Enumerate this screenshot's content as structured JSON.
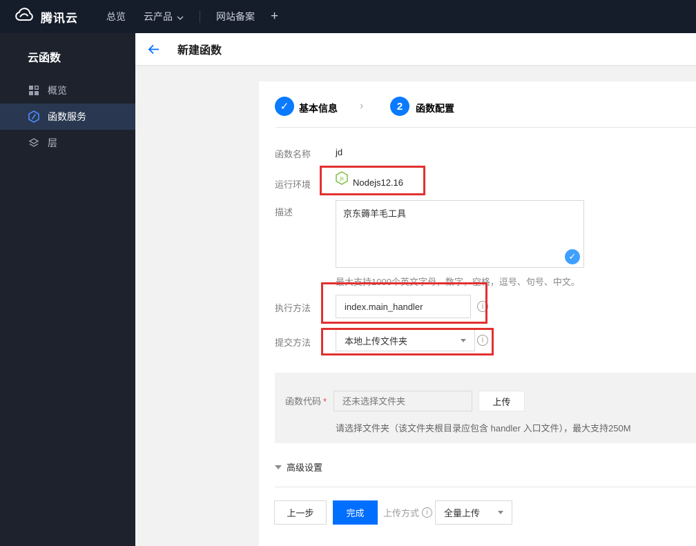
{
  "navbar": {
    "brand": "腾讯云",
    "items": [
      {
        "label": "总览"
      },
      {
        "label": "云产品"
      },
      {
        "label": "网站备案"
      },
      {
        "label": "+"
      }
    ]
  },
  "sidebar": {
    "title": "云函数",
    "items": [
      {
        "label": "概览",
        "icon": "grid-icon",
        "active": false
      },
      {
        "label": "函数服务",
        "icon": "function-hexagon-icon",
        "active": true
      },
      {
        "label": "层",
        "icon": "layers-icon",
        "active": false
      }
    ]
  },
  "header": {
    "title": "新建函数",
    "back_icon": "arrow-left"
  },
  "steps": [
    {
      "mark": "✓",
      "label": "基本信息",
      "state": "done"
    },
    {
      "mark": "2",
      "label": "函数配置",
      "state": "current"
    }
  ],
  "form": {
    "function_name": {
      "label": "函数名称",
      "value": "jd"
    },
    "runtime": {
      "label": "运行环境",
      "value": "Nodejs12.16",
      "icon": "nodejs-icon"
    },
    "description": {
      "label": "描述",
      "value": "京东薅羊毛工具",
      "hint": "最大支持1000个英文字母，数字，空格，逗号、句号、中文。"
    },
    "handler": {
      "label": "执行方法",
      "value": "index.main_handler"
    },
    "submit_method": {
      "label": "提交方法",
      "value": "本地上传文件夹"
    },
    "function_code": {
      "label": "函数代码",
      "required_mark": "*",
      "placeholder": "还未选择文件夹",
      "upload_button": "上传",
      "hint": "请选择文件夹（该文件夹根目录应包含 handler 入口文件），最大支持250M"
    },
    "advanced_label": "高级设置"
  },
  "footer": {
    "prev_button": "上一步",
    "finish_button": "完成",
    "upload_mode_label": "上传方式",
    "upload_mode_value": "全量上传",
    "info_glyph": "i"
  },
  "colors": {
    "accent_blue": "#006eff",
    "step_blue": "#0a7bff",
    "valid_check_blue": "#3fa0ff",
    "annotation_red": "#e23030",
    "node_green": "#7fbe42",
    "navbar_bg": "#151c2a",
    "sidebar_bg": "#1d222d",
    "sidebar_active_bg": "#293850",
    "page_bg": "#f2f2f2"
  }
}
